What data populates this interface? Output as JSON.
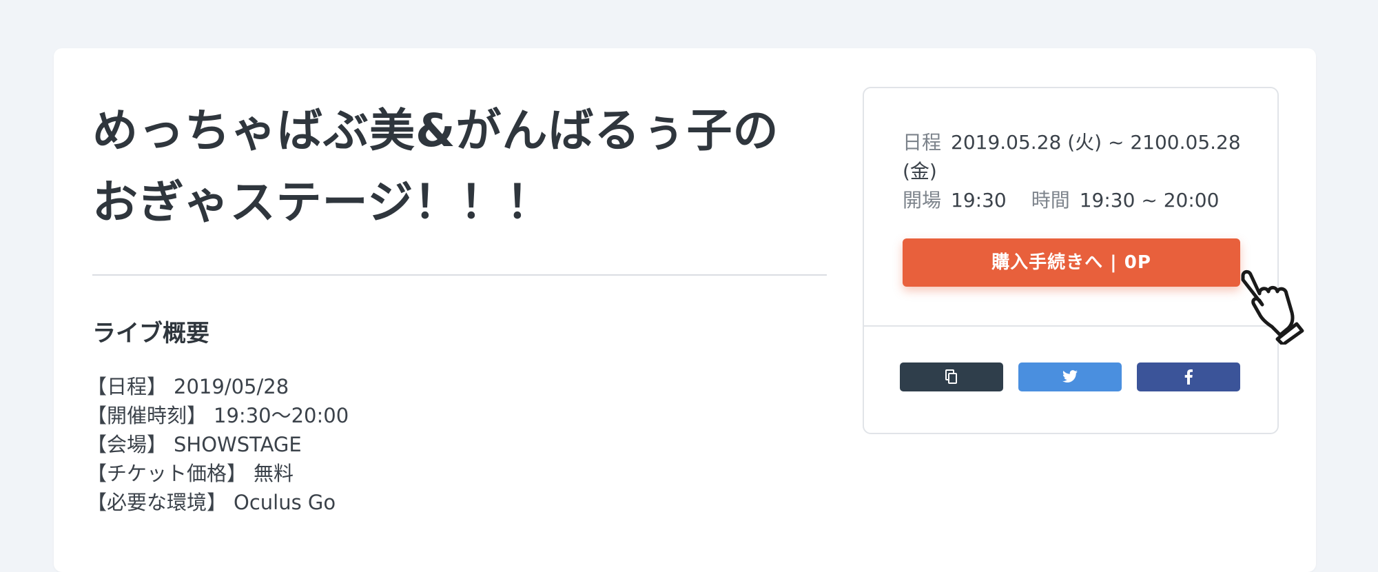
{
  "event": {
    "title": "めっちゃばぶ美&がんばるぅ子のおぎゃステージ！！！"
  },
  "overview": {
    "heading": "ライブ概要",
    "items": [
      {
        "label": "【日程】",
        "value": "2019/05/28"
      },
      {
        "label": "【開催時刻】",
        "value": "19:30〜20:00"
      },
      {
        "label": "【会場】",
        "value": "SHOWSTAGE"
      },
      {
        "label": "【チケット価格】",
        "value": "無料"
      },
      {
        "label": "【必要な環境】",
        "value": "Oculus Go"
      }
    ]
  },
  "ticket_panel": {
    "date_label": "日程",
    "date_value": "2019.05.28 (火) ~ 2100.05.28 (金)",
    "open_label": "開場",
    "open_value": "19:30",
    "time_label": "時間",
    "time_value": "19:30 ~ 20:00",
    "buy_label": "購入手続きへ | 0P"
  },
  "share": {
    "buttons": [
      {
        "icon": "copy-icon",
        "color": "#2f3e4b"
      },
      {
        "icon": "twitter-icon",
        "color": "#4a8fdf"
      },
      {
        "icon": "facebook-icon",
        "color": "#3b5499"
      }
    ]
  },
  "colors": {
    "accent": "#e8603c",
    "background": "#f1f4f8"
  }
}
